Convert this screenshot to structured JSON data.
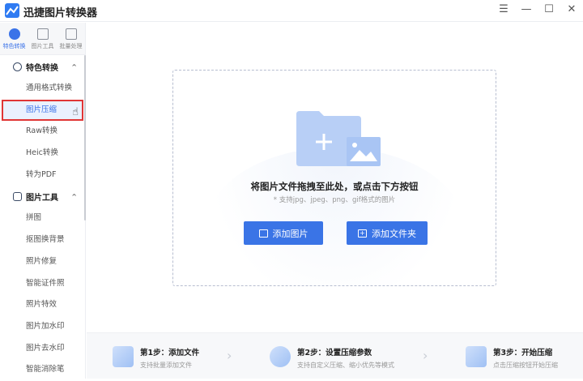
{
  "app": {
    "title": "迅捷图片转换器"
  },
  "window": {
    "menu": "☰",
    "minimize": "—",
    "maximize": "☐",
    "close": "✕"
  },
  "toptabs": [
    {
      "label": "特色转换",
      "active": true
    },
    {
      "label": "图片工具"
    },
    {
      "label": "批量处理"
    }
  ],
  "sidebar": {
    "groups": [
      {
        "label": "特色转换",
        "items": [
          "通用格式转换",
          "图片压缩",
          "Raw转换",
          "Heic转换",
          "转为PDF"
        ]
      },
      {
        "label": "图片工具",
        "items": [
          "拼图",
          "抠图换背景",
          "照片修复",
          "智能证件照",
          "照片特效",
          "图片加水印",
          "图片去水印",
          "智能消除笔"
        ]
      }
    ],
    "selected": "图片压缩"
  },
  "drop": {
    "title": "将图片文件拖拽至此处，或点击下方按钮",
    "subtitle": "* 支持jpg、jpeg、png、gif格式的图片",
    "add_image": "添加图片",
    "add_folder": "添加文件夹"
  },
  "steps": [
    {
      "title": "第1步：添加文件",
      "desc": "支持批量添加文件"
    },
    {
      "title": "第2步：设置压缩参数",
      "desc": "支持自定义压缩、缩小优先等模式"
    },
    {
      "title": "第3步：开始压缩",
      "desc": "点击压缩按钮开始压缩"
    }
  ],
  "colors": {
    "accent": "#3a74e6",
    "highlight": "#e03636"
  }
}
